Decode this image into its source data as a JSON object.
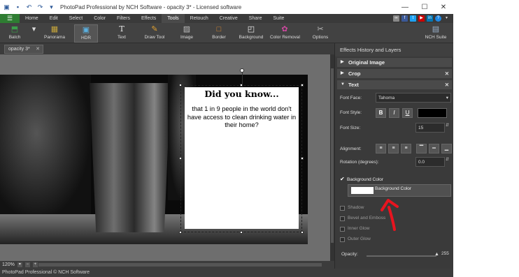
{
  "window": {
    "title": "PhotoPad Professional by NCH Software - opacity 3* - Licensed software",
    "controls": [
      "—",
      "☐",
      "✕"
    ]
  },
  "menu": {
    "tabs": [
      "Home",
      "Edit",
      "Select",
      "Color",
      "Filters",
      "Effects",
      "Tools",
      "Retouch",
      "Creative",
      "Share",
      "Suite"
    ],
    "active_tab": "Tools"
  },
  "toolbar": {
    "buttons": [
      {
        "label": "Batch",
        "icon": "batch-icon"
      },
      {
        "label": "Panorama",
        "icon": "panorama-icon"
      },
      {
        "label": "HDR",
        "icon": "hdr-icon"
      },
      {
        "label": "Text",
        "icon": "text-icon"
      },
      {
        "label": "Draw Tool",
        "icon": "draw-tool-icon"
      },
      {
        "label": "Image",
        "icon": "image-icon"
      },
      {
        "label": "Border",
        "icon": "border-icon"
      },
      {
        "label": "Background",
        "icon": "background-icon"
      },
      {
        "label": "Color Removal",
        "icon": "color-removal-icon"
      },
      {
        "label": "Options",
        "icon": "options-icon"
      },
      {
        "label": "NCH Suite",
        "icon": "nch-suite-icon"
      }
    ],
    "selected": "HDR"
  },
  "document_tab": {
    "label": "opacity 3*",
    "close": "✕"
  },
  "canvas": {
    "heading": "Did you know...",
    "body": "that 1 in 9 people in the world don't have access to clean drinking water in their home?"
  },
  "status": {
    "zoom": "120%"
  },
  "footer": {
    "text": "PhotoPad Professional © NCH Software"
  },
  "panel": {
    "title": "Effects History and Layers",
    "sections": [
      {
        "label": "Original Image",
        "expanded": false
      },
      {
        "label": "Crop",
        "expanded": false
      },
      {
        "label": "Text",
        "expanded": true
      }
    ],
    "font_face_label": "Font Face:",
    "font_face": "Tahoma",
    "font_style_label": "Font Style:",
    "bold": "B",
    "italic": "I",
    "underline": "U",
    "font_size_label": "Font Size:",
    "font_size": "15",
    "alignment_label": "Alignment:",
    "rotation_label": "Rotation (degrees):",
    "rotation": "0.0",
    "bg_color_label": "Background Color",
    "bg_color_button": "Background Color",
    "shadow_label": "Shadow",
    "bevel_label": "Bevel and Emboss",
    "inner_glow_label": "Inner Glow",
    "outer_glow_label": "Outer Glow",
    "opacity_label": "Opacity:",
    "opacity": "255"
  },
  "colors": {
    "accent": "#2e7d32",
    "arrow": "#e8141f",
    "panel_bg": "#3a3a3a"
  }
}
